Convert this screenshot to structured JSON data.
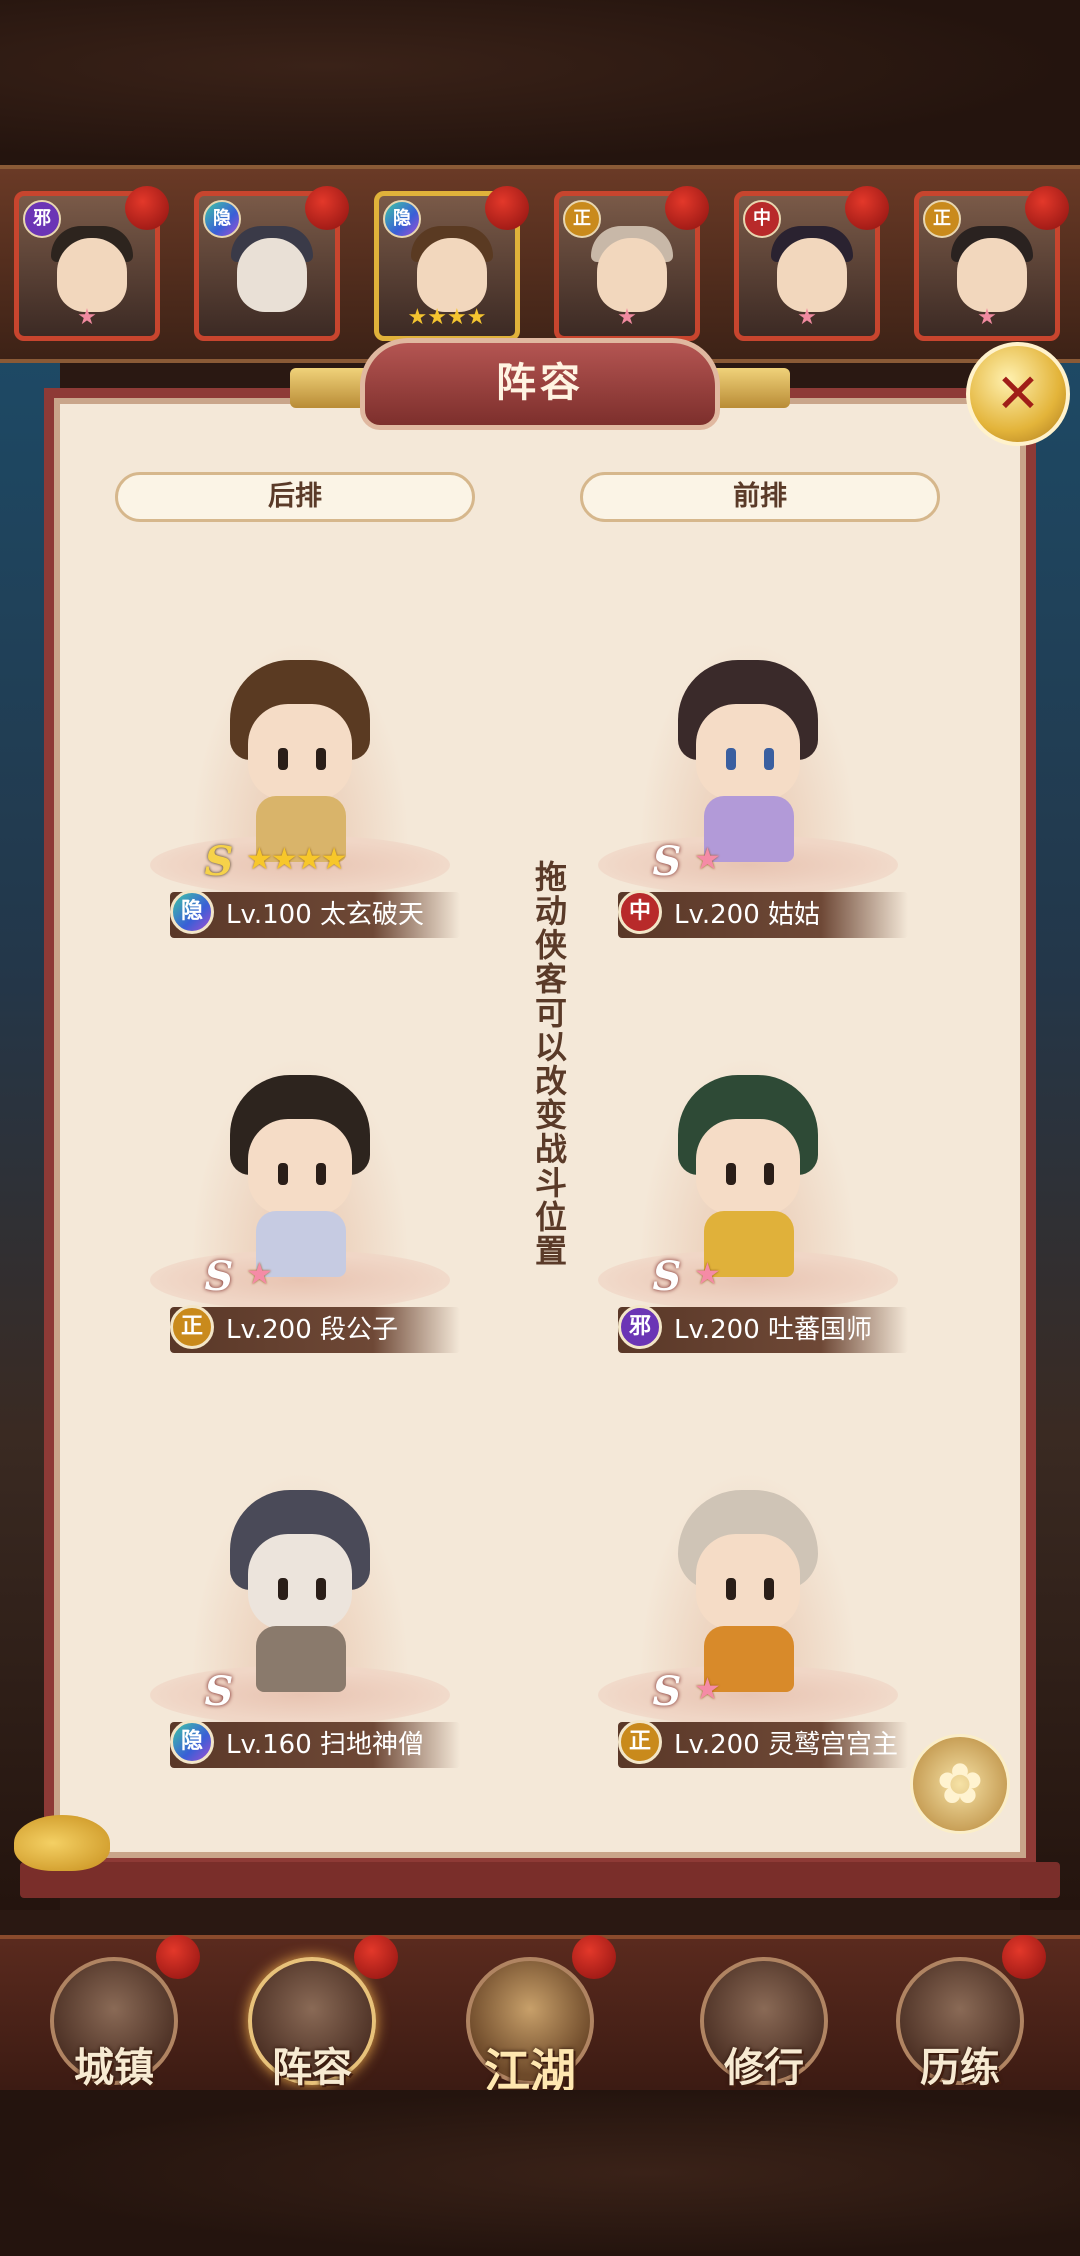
{
  "hero_strip": [
    {
      "faction": "邪",
      "faction_color": "#6b35b5",
      "stars": "★",
      "star_type": "pink",
      "border": "red"
    },
    {
      "faction": "隐",
      "faction_color": "#3a5fd6",
      "stars": "",
      "star_type": "pink",
      "border": "red"
    },
    {
      "faction": "隐",
      "faction_color": "#3a5fd6",
      "stars": "★★★★",
      "star_type": "gold",
      "border": "gold"
    },
    {
      "faction": "正",
      "faction_color": "#c98a1c",
      "stars": "★",
      "star_type": "pink",
      "border": "red"
    },
    {
      "faction": "中",
      "faction_color": "#b82a2a",
      "stars": "★",
      "star_type": "pink",
      "border": "red"
    },
    {
      "faction": "正",
      "faction_color": "#c98a1c",
      "stars": "★",
      "star_type": "pink",
      "border": "red"
    }
  ],
  "panel": {
    "title": "阵容",
    "close_icon": "crossed-swords-icon",
    "back_row_label": "后排",
    "front_row_label": "前排",
    "drag_hint": "拖动侠客可以改变战斗位置"
  },
  "slots": {
    "back1": {
      "faction": "隐",
      "grade": "S",
      "stars": "★★★★",
      "text": "Lv.100 太玄破天"
    },
    "front1": {
      "faction": "中",
      "grade": "S",
      "stars": "★",
      "text": "Lv.200 姑姑"
    },
    "back2": {
      "faction": "正",
      "grade": "S",
      "stars": "★",
      "text": "Lv.200 段公子"
    },
    "front2": {
      "faction": "邪",
      "grade": "S",
      "stars": "★",
      "text": "Lv.200 吐蕃国师"
    },
    "back3": {
      "faction": "隐",
      "grade": "S",
      "stars": "",
      "text": "Lv.160 扫地神僧"
    },
    "front3": {
      "faction": "正",
      "grade": "S",
      "stars": "★",
      "text": "Lv.200 灵鹫宫宫主"
    }
  },
  "nav": {
    "town": "城镇",
    "lineup": "阵容",
    "jianghu": "江湖",
    "training": "修行",
    "experience": "历练"
  },
  "colors": {
    "panel_bg": "#f4e8d8",
    "panel_border": "#8e3a36",
    "accent_red": "#b45552"
  }
}
